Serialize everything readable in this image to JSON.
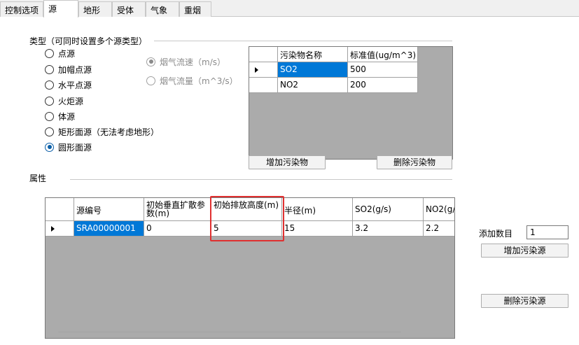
{
  "tabs": [
    "控制选项",
    "源",
    "地形",
    "受体",
    "气象",
    "重烟"
  ],
  "type_group": {
    "label": "类型（可同时设置多个源类型）",
    "options": [
      "点源",
      "加帽点源",
      "水平点源",
      "火炬源",
      "体源",
      "矩形面源（无法考虑地形）",
      "圆形面源"
    ],
    "selected": "圆形面源"
  },
  "flow_options": {
    "velocity": "烟气流速（m/s）",
    "flow": "烟气流量（m^3/s）"
  },
  "pollutant_table": {
    "headers": [
      "污染物名称",
      "标准值(ug/m^3)"
    ],
    "rows": [
      [
        "SO2",
        "500"
      ],
      [
        "NO2",
        "200"
      ]
    ]
  },
  "pollutant_buttons": {
    "add": "增加污染物",
    "delete": "删除污染物"
  },
  "attr_label": "属性",
  "source_table": {
    "headers": [
      "源编号",
      "初始垂直扩散参数(m)",
      "初始排放高度(m)",
      "半径(m)",
      "SO2(g/s)",
      "NO2(g/"
    ],
    "row": [
      "SRA00000001",
      "0",
      "5",
      "15",
      "3.2",
      "2.2"
    ]
  },
  "add_count": {
    "label": "添加数目",
    "value": "1"
  },
  "source_buttons": {
    "add": "增加污染源",
    "delete": "删除污染源"
  },
  "colors": {
    "selection": "#0078d7",
    "highlight_box": "#e03030",
    "grid_background": "#ababab"
  }
}
